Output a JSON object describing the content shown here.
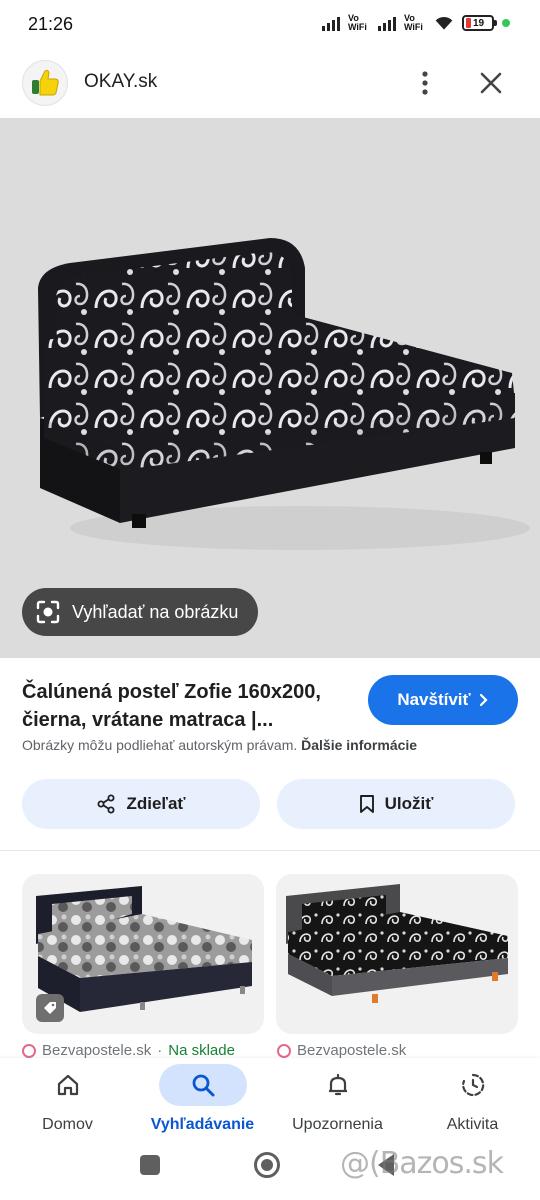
{
  "status_bar": {
    "time": "21:26",
    "vowifi_1": "Vo\nWiFi",
    "vowifi_2": "Vo\nWiFi",
    "battery": "19"
  },
  "header": {
    "site_name": "OKAY.sk",
    "more_icon": "more-vert-icon",
    "close_icon": "close-icon"
  },
  "image": {
    "lens_label": "Vyhľadať na obrázku"
  },
  "result": {
    "title": "Čalúnená posteľ Zofie 160x200, čierna, vrátane matraca |...",
    "visit_label": "Navštíviť",
    "copyright_text": "Obrázky môžu podliehať autorským právam.",
    "copyright_link": "Ďalšie informácie",
    "share_label": "Zdieľať",
    "save_label": "Uložiť"
  },
  "related": [
    {
      "source": "Bezvapostele.sk",
      "separator": "·",
      "stock": "Na sklade"
    },
    {
      "source": "Bezvapostele.sk"
    }
  ],
  "bottom_nav": [
    {
      "label": "Domov",
      "icon": "home-icon"
    },
    {
      "label": "Vyhľadávanie",
      "icon": "search-icon",
      "active": true
    },
    {
      "label": "Upozornenia",
      "icon": "bell-icon"
    },
    {
      "label": "Aktivita",
      "icon": "activity-icon"
    }
  ],
  "watermark": "@(Bazos.sk",
  "colors": {
    "accent": "#1a73e8",
    "chip": "#474747",
    "tonal_button": "#e8f0fe",
    "nav_active": "#d3e3fd",
    "stock_green": "#188038"
  }
}
